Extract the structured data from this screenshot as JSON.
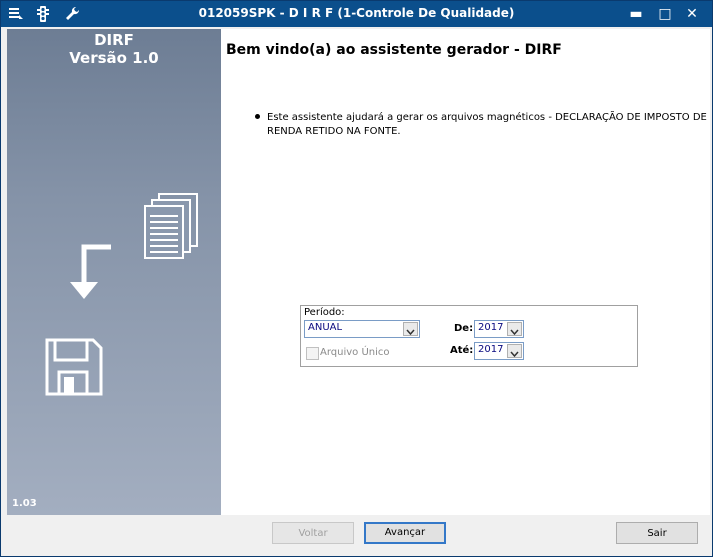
{
  "window": {
    "title": "012059SPK - D I R F (1-Controle De Qualidade)",
    "minimize": "▬",
    "maximize": "□",
    "close": "✕",
    "titlebar_color": "#0b4f8c"
  },
  "sidebar": {
    "title": "DIRF",
    "version": "Versão 1.0",
    "build": "1.03"
  },
  "main": {
    "heading": "Bem vindo(a) ao assistente gerador - DIRF",
    "intro": "Este assistente ajudará a gerar os arquivos magnéticos - DECLARAÇÃO DE IMPOSTO DE RENDA RETIDO NA FONTE."
  },
  "period": {
    "label": "Período:",
    "type_value": "ANUAL",
    "from_label": "De:",
    "from_value": "2017",
    "to_label": "Até:",
    "to_value": "2017",
    "single_file_label": "Arquivo Único"
  },
  "footer": {
    "back": "Voltar",
    "next": "Avançar",
    "exit": "Sair"
  }
}
